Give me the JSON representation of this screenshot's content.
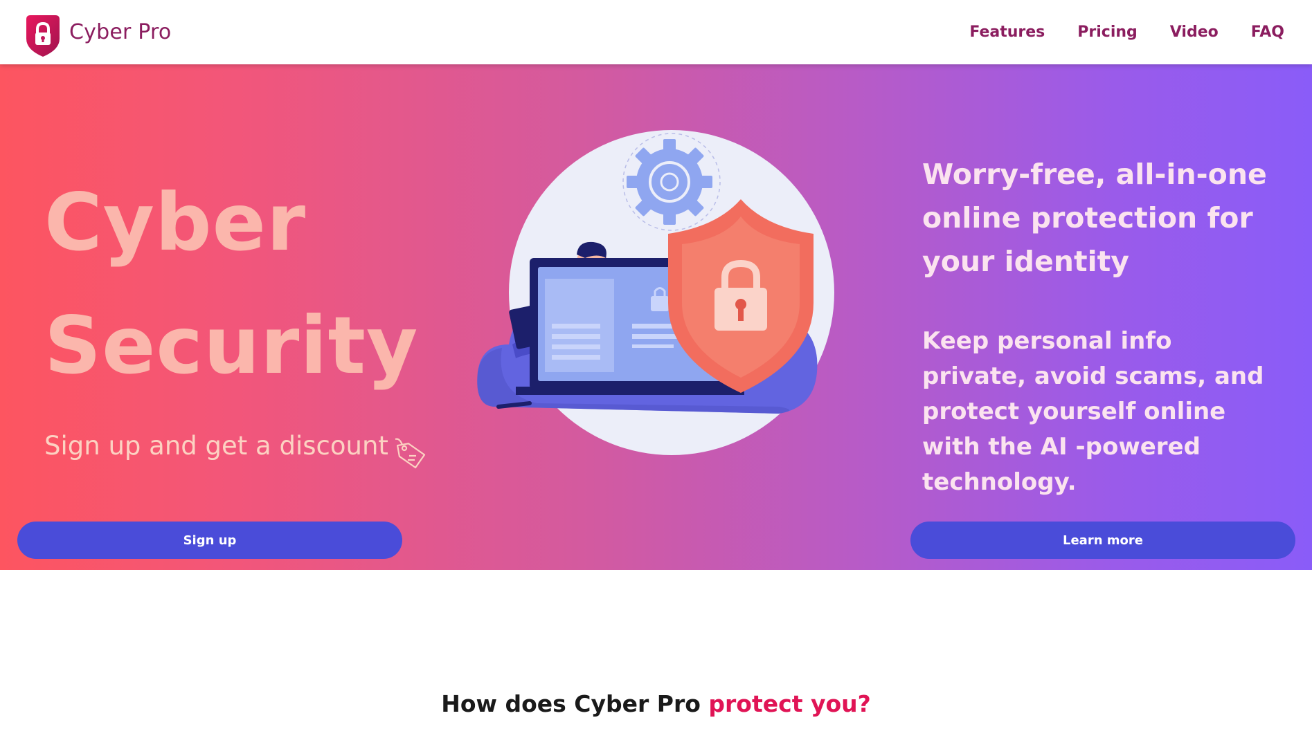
{
  "header": {
    "logo_text": "Cyber Pro",
    "nav": [
      "Features",
      "Pricing",
      "Video",
      "FAQ"
    ]
  },
  "hero": {
    "title_line1": "Cyber",
    "title_line2": "Security",
    "subtitle": "Sign up and get a discount",
    "heading": "Worry-free, all-in-one online protection for your identity",
    "description": "Keep personal info private, avoid scams, and protect yourself online with the AI -powered technology.",
    "signup_label": "Sign up",
    "learn_more_label": "Learn more"
  },
  "section": {
    "title_plain": "How does Cyber Pro",
    "title_accent": "protect you?"
  },
  "colors": {
    "brand": "#8b1d5f",
    "accent": "#e01455",
    "button": "#4a4cd9",
    "gradient_start": "#fd5560",
    "gradient_end": "#8a5cf8"
  },
  "icons": [
    "lock-shield-logo-icon",
    "tag-icon",
    "security-illustration"
  ]
}
